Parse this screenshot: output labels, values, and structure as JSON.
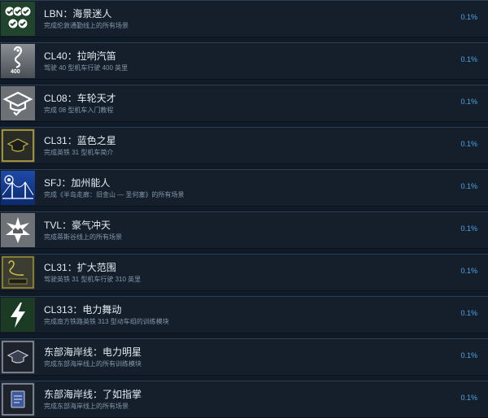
{
  "achievements": [
    {
      "title": "LBN：海景迷人",
      "description": "完成伦敦通勤线上的所有场景",
      "percent": "0.1%",
      "icon": "checkmarks-icon"
    },
    {
      "title": "CL40：拉响汽笛",
      "description": "驾驶 40 型机车行驶 400 英里",
      "percent": "0.1%",
      "icon": "route-400-icon",
      "badge": "400"
    },
    {
      "title": "CL08：车轮天才",
      "description": "完成 08 型机车入门教程",
      "percent": "0.1%",
      "icon": "graduation-cap-icon"
    },
    {
      "title": "CL31：蓝色之星",
      "description": "完成英铁 31 型机车简介",
      "percent": "0.1%",
      "icon": "gold-cap-icon"
    },
    {
      "title": "SFJ：加州能人",
      "description": "完成《半岛走廊：旧金山 — 圣何塞》的所有场景",
      "percent": "0.1%",
      "icon": "bridge-icon"
    },
    {
      "title": "TVL：豪气冲天",
      "description": "完成蒂斯谷线上的所有场景",
      "percent": "0.1%",
      "icon": "star-burst-icon"
    },
    {
      "title": "CL31：扩大范围",
      "description": "驾驶英铁 31 型机车行驶 310 英里",
      "percent": "0.1%",
      "icon": "map-route-icon"
    },
    {
      "title": "CL313：电力舞动",
      "description": "完成南方铁路英铁 313 型动车组的训练模块",
      "percent": "0.1%",
      "icon": "lightning-icon"
    },
    {
      "title": "东部海岸线：电力明星",
      "description": "完成东部海岸线上的所有训练模块",
      "percent": "0.1%",
      "icon": "cap-frame-icon"
    },
    {
      "title": "东部海岸线：了如指掌",
      "description": "完成东部海岸线上的所有场景",
      "percent": "0.1%",
      "icon": "book-icon"
    }
  ]
}
